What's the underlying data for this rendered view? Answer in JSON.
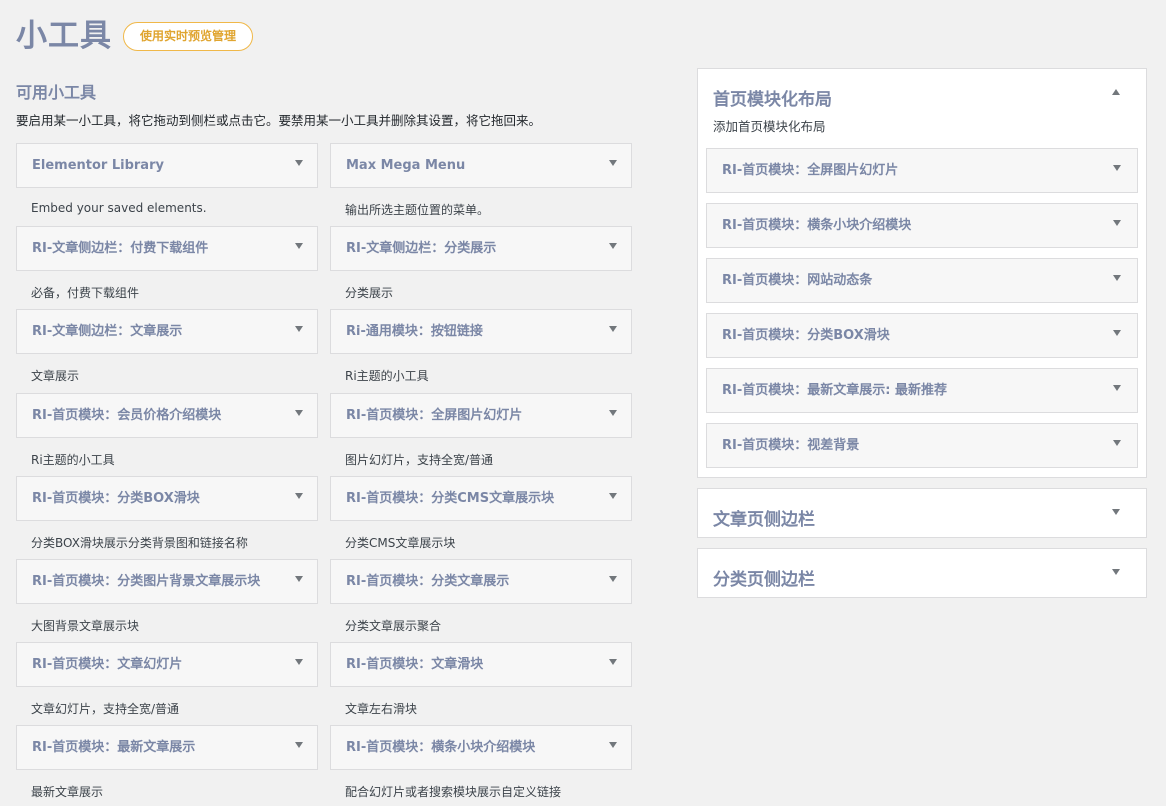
{
  "header": {
    "title": "小工具",
    "live_preview_label": "使用实时预览管理"
  },
  "available": {
    "title": "可用小工具",
    "description": "要启用某一小工具，将它拖动到侧栏或点击它。要禁用某一小工具并删除其设置，将它拖回来。",
    "widgets": [
      {
        "name": "Elementor Library",
        "desc": "Embed your saved elements."
      },
      {
        "name": "Max Mega Menu",
        "desc": "输出所选主题位置的菜单。"
      },
      {
        "name": "RI-文章侧边栏：付费下载组件",
        "desc": "必备，付费下载组件"
      },
      {
        "name": "RI-文章侧边栏：分类展示",
        "desc": "分类展示"
      },
      {
        "name": "RI-文章侧边栏：文章展示",
        "desc": "文章展示"
      },
      {
        "name": "Ri-通用模块：按钮链接",
        "desc": "Ri主题的小工具"
      },
      {
        "name": "RI-首页模块：会员价格介绍模块",
        "desc": "Ri主题的小工具"
      },
      {
        "name": "RI-首页模块：全屏图片幻灯片",
        "desc": "图片幻灯片，支持全宽/普通"
      },
      {
        "name": "RI-首页模块：分类BOX滑块",
        "desc": "分类BOX滑块展示分类背景图和链接名称"
      },
      {
        "name": "RI-首页模块：分类CMS文章展示块",
        "desc": "分类CMS文章展示块"
      },
      {
        "name": "RI-首页模块：分类图片背景文章展示块",
        "desc": "大图背景文章展示块"
      },
      {
        "name": "RI-首页模块：分类文章展示",
        "desc": "分类文章展示聚合"
      },
      {
        "name": "RI-首页模块：文章幻灯片",
        "desc": "文章幻灯片，支持全宽/普通"
      },
      {
        "name": "RI-首页模块：文章滑块",
        "desc": "文章左右滑块"
      },
      {
        "name": "RI-首页模块：最新文章展示",
        "desc": "最新文章展示"
      },
      {
        "name": "RI-首页模块：横条小块介绍模块",
        "desc": "配合幻灯片或者搜索模块展示自定义链接"
      }
    ]
  },
  "sidebars": {
    "home": {
      "title": "首页模块化布局",
      "description": "添加首页模块化布局",
      "widgets": [
        "RI-首页模块：全屏图片幻灯片",
        "RI-首页模块：横条小块介绍模块",
        "RI-首页模块：网站动态条",
        "RI-首页模块：分类BOX滑块",
        "RI-首页模块：最新文章展示: 最新推荐",
        "RI-首页模块：视差背景"
      ]
    },
    "article": {
      "title": "文章页侧边栏"
    },
    "category": {
      "title": "分类页侧边栏"
    }
  },
  "colors": {
    "accent_title": "#7b87a6",
    "preview_button": "#f0b849",
    "background": "#f1f1f1"
  },
  "icons": {
    "collapsed": "caret-down-icon",
    "expanded": "caret-up-icon"
  }
}
